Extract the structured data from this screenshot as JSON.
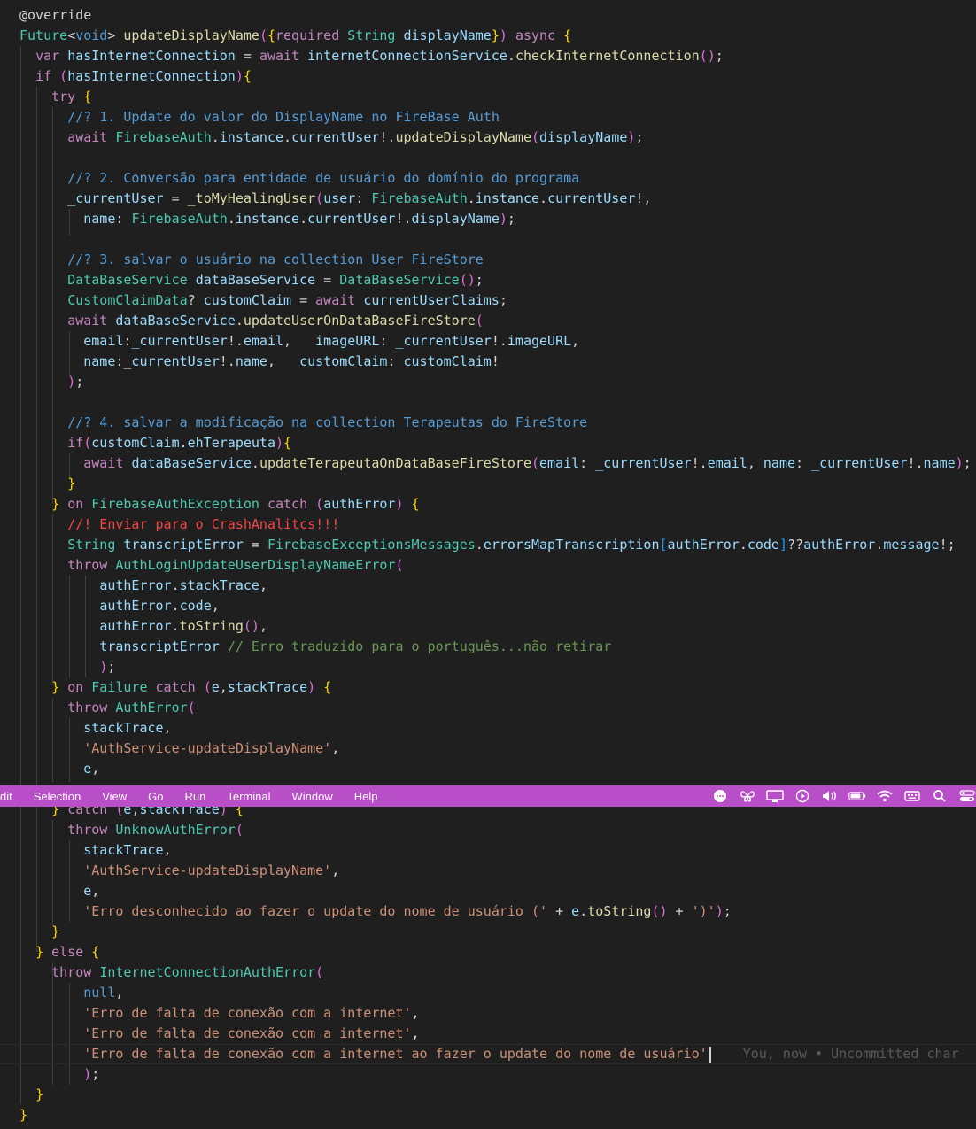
{
  "editor": {
    "lines": [
      "@override",
      "Future<void> updateDisplayName({required String displayName}) async {",
      "  var hasInternetConnection = await internetConnectionService.checkInternetConnection();",
      "  if (hasInternetConnection){",
      "    try {",
      "      //? 1. Update do valor do DisplayName no FireBase Auth",
      "      await FirebaseAuth.instance.currentUser!.updateDisplayName(displayName);",
      "",
      "      //? 2. Conversão para entidade de usuário do domínio do programa",
      "      _currentUser = _toMyHealingUser(user: FirebaseAuth.instance.currentUser!,",
      "        name: FirebaseAuth.instance.currentUser!.displayName);",
      "",
      "      //? 3. salvar o usuário na collection User FireStore",
      "      DataBaseService dataBaseService = DataBaseService();",
      "      CustomClaimData? customClaim = await currentUserClaims;",
      "      await dataBaseService.updateUserOnDataBaseFireStore(",
      "        email:_currentUser!.email,   imageURL: _currentUser!.imageURL,",
      "        name:_currentUser!.name,   customClaim: customClaim!",
      "      );",
      "",
      "      //? 4. salvar a modificação na collection Terapeutas do FireStore",
      "      if(customClaim.ehTerapeuta){",
      "        await dataBaseService.updateTerapeutaOnDataBaseFireStore(email: _currentUser!.email, name: _currentUser!.name);",
      "      }",
      "    } on FirebaseAuthException catch (authError) {",
      "      //! Enviar para o CrashAnalitcs!!!",
      "      String transcriptError = FirebaseExceptionsMessages.errorsMapTranscription[authError.code]??authError.message!;",
      "      throw AuthLoginUpdateUserDisplayNameError(",
      "          authError.stackTrace,",
      "          authError.code,",
      "          authError.toString(),",
      "          transcriptError // Erro traduzido para o português...não retirar",
      "          );",
      "    } on Failure catch (e,stackTrace) {",
      "      throw AuthError(",
      "        stackTrace,",
      "        'AuthService-updateDisplayName',",
      "        e,",
      "    } catch (e,stackTrace) {",
      "      throw UnknowAuthError(",
      "        stackTrace,",
      "        'AuthService-updateDisplayName',",
      "        e,",
      "        'Erro desconhecido ao fazer o update do nome de usuário (' + e.toString() + ')');",
      "    }",
      "  } else {",
      "    throw InternetConnectionAuthError(",
      "        null,",
      "        'Erro de falta de conexão com a internet',",
      "        'Erro de falta de conexão com a internet',",
      "        'Erro de falta de conexão com a internet ao fazer o update do nome de usuário'",
      "        );",
      "  }",
      "}"
    ],
    "blame_hint": "You, now • Uncommitted char"
  },
  "menubar": {
    "items": [
      "dit",
      "Selection",
      "View",
      "Go",
      "Run",
      "Terminal",
      "Window",
      "Help"
    ],
    "tray_icons": [
      "messenger-icon",
      "butterfly-icon",
      "display-icon",
      "play-icon",
      "volume-icon",
      "battery-icon",
      "wifi-icon",
      "keyboard-icon",
      "search-icon",
      "control-center-icon"
    ],
    "accent_color": "#b94fc8"
  }
}
